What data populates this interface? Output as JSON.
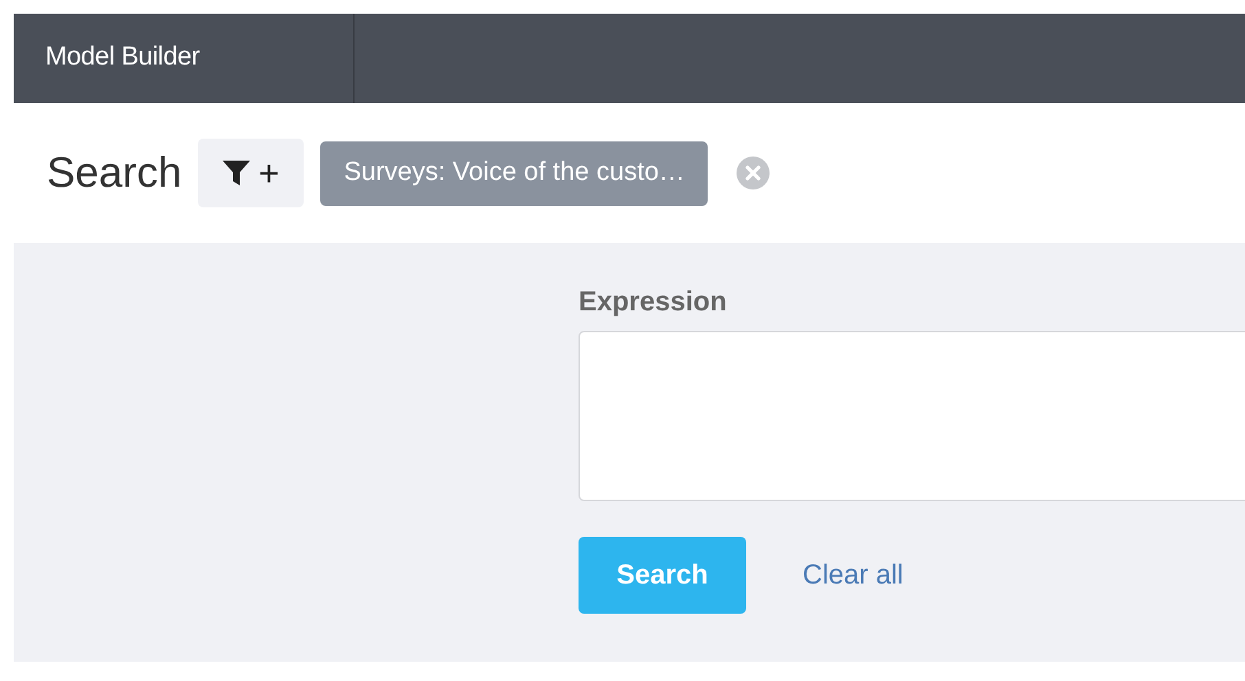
{
  "header": {
    "title": "Model Builder"
  },
  "search_bar": {
    "label": "Search",
    "add_filter_button": "+",
    "filters": [
      {
        "label": "Surveys: Voice of the custo…"
      }
    ]
  },
  "form": {
    "expression_label": "Expression",
    "search_button": "Search",
    "clear_link": "Clear all"
  }
}
